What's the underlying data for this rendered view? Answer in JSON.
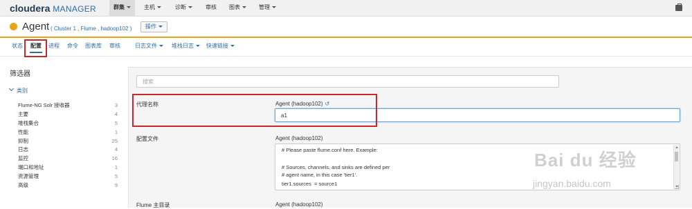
{
  "topnav": {
    "logo_brand": "cloudera",
    "logo_product": "MANAGER",
    "items": [
      {
        "label": "群集"
      },
      {
        "label": "主机"
      },
      {
        "label": "诊断"
      },
      {
        "label": "审核"
      },
      {
        "label": "图表"
      },
      {
        "label": "管理"
      }
    ],
    "right_icon": "briefcase-icon"
  },
  "header": {
    "status_color": "#e8a317",
    "title": "Agent",
    "subtitle": "( Cluster 1 , Flume , hadoop102 )",
    "actions_label": "操作"
  },
  "subnav": {
    "items": [
      {
        "label": "状态"
      },
      {
        "label": "配置"
      },
      {
        "label": "进程"
      },
      {
        "label": "命令"
      },
      {
        "label": "图表库"
      },
      {
        "label": "审核"
      },
      {
        "label": "日志文件"
      },
      {
        "label": "堆栈日志"
      },
      {
        "label": "快速链接"
      }
    ],
    "active": "配置"
  },
  "sidebar": {
    "title": "筛选器",
    "category_label": "类别",
    "filters": [
      {
        "label": "Flume-NG Solr 接收器",
        "count": "3"
      },
      {
        "label": "主要",
        "count": "4"
      },
      {
        "label": "堆栈集合",
        "count": "5"
      },
      {
        "label": "性能",
        "count": "1"
      },
      {
        "label": "抑制",
        "count": "25"
      },
      {
        "label": "日志",
        "count": "4"
      },
      {
        "label": "监控",
        "count": "16"
      },
      {
        "label": "端口和地址",
        "count": "1"
      },
      {
        "label": "资源管理",
        "count": "5"
      },
      {
        "label": "高级",
        "count": "9"
      }
    ]
  },
  "main": {
    "search_placeholder": "搜索",
    "agent_name": {
      "label": "代理名称",
      "scope": "Agent (hadoop102)",
      "value": "a1"
    },
    "config_file": {
      "label": "配置文件",
      "scope": "Agent (hadoop102)",
      "lines": [
        "# Please paste flume.conf here. Example:",
        "",
        "# Sources, channels, and sinks are defined per",
        "# agent name, in this case 'tier1'.",
        "tier1.sources  = source1"
      ]
    },
    "flume_home": {
      "label": "Flume 主目录",
      "scope": "Agent (hadoop102)"
    }
  },
  "watermark": {
    "logo": "Bai du 经验",
    "url": "jingyan.baidu.com"
  },
  "colors": {
    "accent": "#2c6ea8",
    "status": "#e8a317",
    "highlight": "#c9272c"
  }
}
